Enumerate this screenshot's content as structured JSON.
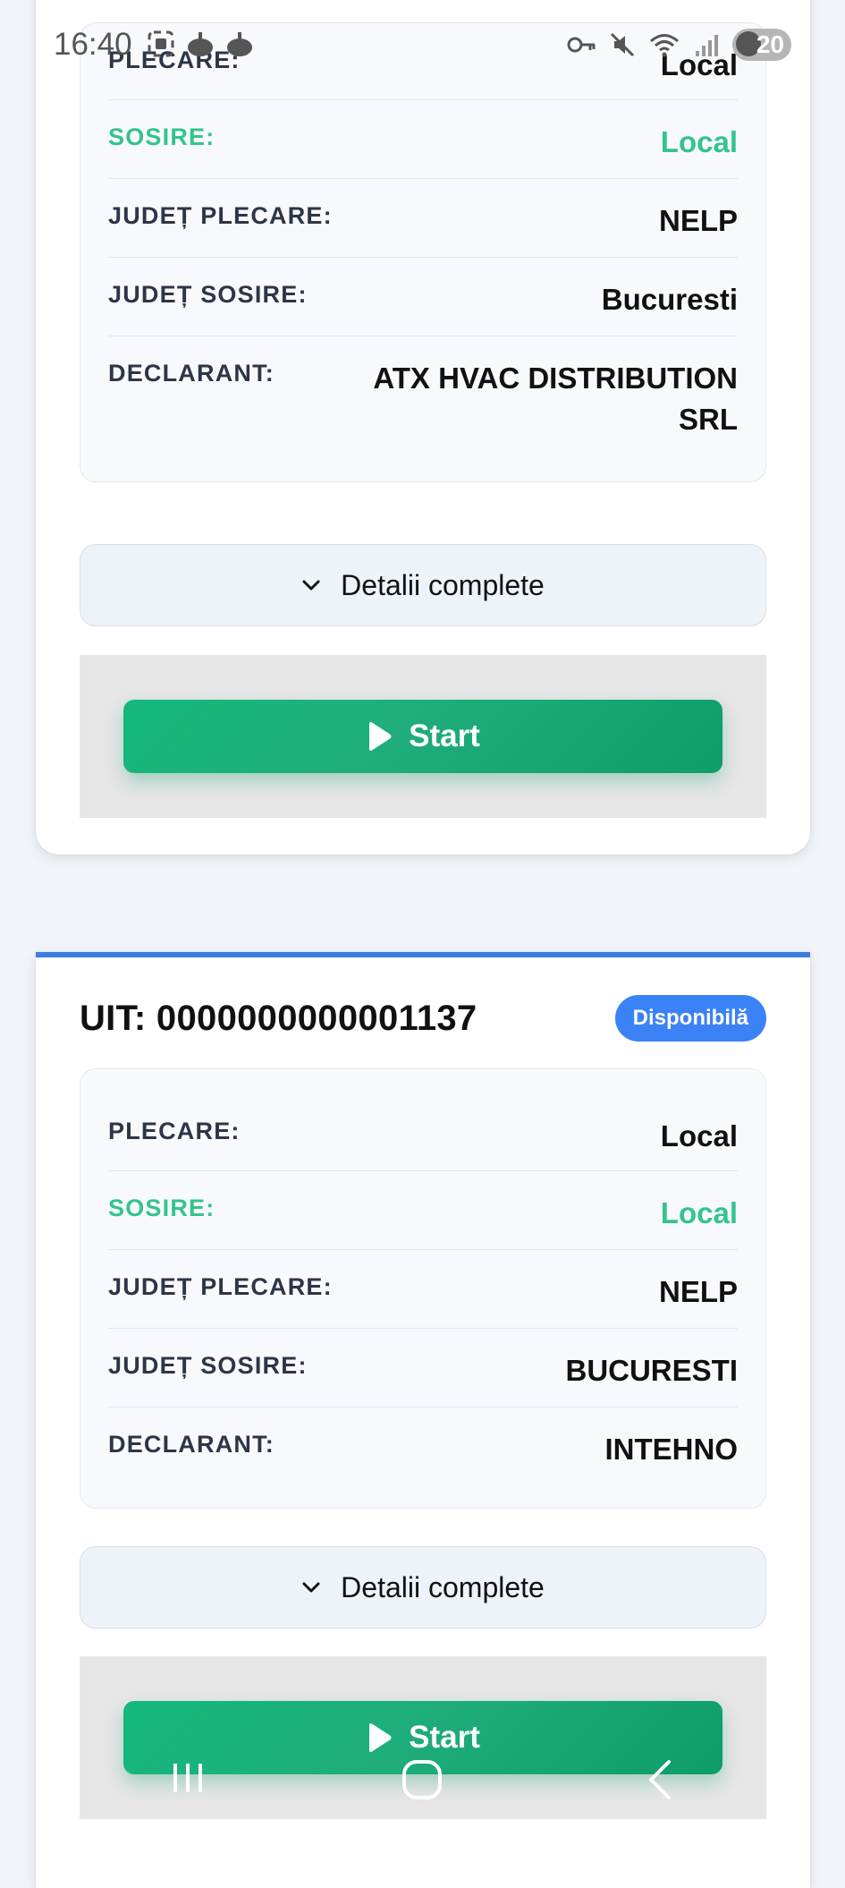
{
  "status_bar": {
    "time": "16:40",
    "left_icons": [
      "screenshot-icon",
      "app-icon",
      "app-icon"
    ],
    "right_icons": [
      "vpn-key-icon",
      "mute-icon",
      "wifi-icon",
      "signal-icon"
    ],
    "battery": "20"
  },
  "cards": [
    {
      "uit": "",
      "status": "",
      "rows": [
        {
          "label": "PLECARE:",
          "value": "Local"
        },
        {
          "label": "SOSIRE:",
          "value": "Local"
        },
        {
          "label": "JUDEȚ PLECARE:",
          "value": "NELP"
        },
        {
          "label": "JUDEȚ SOSIRE:",
          "value": "Bucuresti"
        },
        {
          "label": "DECLARANT:",
          "value": "ATX HVAC DISTRIBUTION SRL"
        }
      ],
      "details_label": "Detalii complete",
      "start_label": "Start"
    },
    {
      "uit": "UIT: 0000000000001137",
      "status": "Disponibilă",
      "rows": [
        {
          "label": "PLECARE:",
          "value": "Local"
        },
        {
          "label": "SOSIRE:",
          "value": "Local"
        },
        {
          "label": "JUDEȚ PLECARE:",
          "value": "NELP"
        },
        {
          "label": "JUDEȚ SOSIRE:",
          "value": "BUCURESTI"
        },
        {
          "label": "DECLARANT:",
          "value": "INTEHNO"
        }
      ],
      "details_label": "Detalii complete",
      "start_label": "Start"
    }
  ],
  "colors": {
    "accent_blue": "#3b82f6",
    "sosire_green": "#34c38f",
    "start_green": "#14b87c"
  },
  "nav_bar": {
    "icons": [
      "recent-apps-icon",
      "home-icon",
      "back-icon"
    ]
  }
}
